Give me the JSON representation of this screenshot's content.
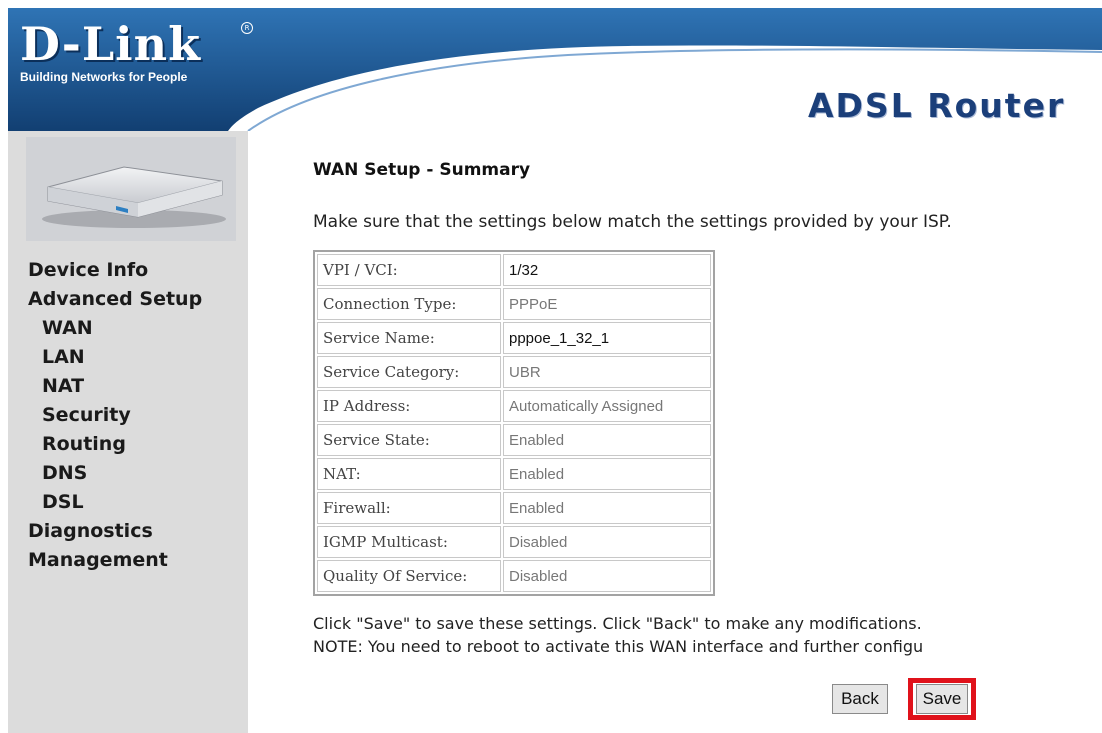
{
  "header": {
    "brand": "D-Link",
    "tagline": "Building Networks for People",
    "registered_mark": "R",
    "product_title": "ADSL Router"
  },
  "sidebar": {
    "items": [
      {
        "label": "Device Info"
      },
      {
        "label": "Advanced Setup"
      },
      {
        "label": "WAN"
      },
      {
        "label": "LAN"
      },
      {
        "label": "NAT"
      },
      {
        "label": "Security"
      },
      {
        "label": "Routing"
      },
      {
        "label": "DNS"
      },
      {
        "label": "DSL"
      },
      {
        "label": "Diagnostics"
      },
      {
        "label": "Management"
      }
    ]
  },
  "main": {
    "title": "WAN Setup - Summary",
    "intro": "Make sure that the settings below match the settings provided by your ISP.",
    "rows": [
      {
        "label": "VPI / VCI:",
        "value": "1/32"
      },
      {
        "label": "Connection Type:",
        "value": "PPPoE"
      },
      {
        "label": "Service Name:",
        "value": "pppoe_1_32_1"
      },
      {
        "label": "Service Category:",
        "value": "UBR"
      },
      {
        "label": "IP Address:",
        "value": "Automatically Assigned"
      },
      {
        "label": "Service State:",
        "value": "Enabled"
      },
      {
        "label": "NAT:",
        "value": "Enabled"
      },
      {
        "label": "Firewall:",
        "value": "Enabled"
      },
      {
        "label": "IGMP Multicast:",
        "value": "Disabled"
      },
      {
        "label": "Quality Of Service:",
        "value": "Disabled"
      }
    ],
    "note_line1": "Click \"Save\" to save these settings. Click \"Back\" to make any modifications.",
    "note_line2": "NOTE: You need to reboot to activate this WAN interface and further configu"
  },
  "buttons": {
    "back": "Back",
    "save": "Save"
  },
  "colors": {
    "header_blue": "#1d5a97",
    "highlight_red": "#e0121b",
    "sidebar_gray": "#dcdcdc"
  }
}
